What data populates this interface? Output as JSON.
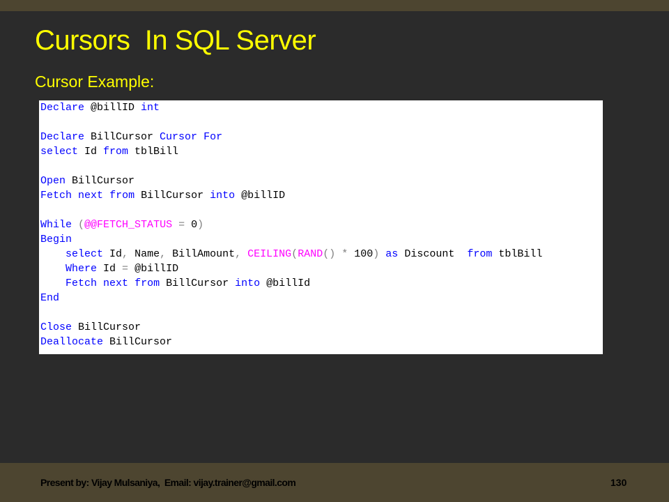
{
  "slide": {
    "title": "Cursors  In SQL Server",
    "subtitle": "Cursor Example:",
    "page_number": "130"
  },
  "footer": {
    "text": "Present by: Vijay Mulsaniya,  Email: vijay.trainer@gmail.com"
  },
  "colors": {
    "background": "#2b2b2b",
    "bar": "#4d4530",
    "title": "#ffff00",
    "keyword": "#0000ff",
    "function": "#ff00ff",
    "operator": "#808080",
    "text": "#000000"
  },
  "code": {
    "lines": [
      [
        {
          "t": "Declare",
          "c": "kw"
        },
        {
          "t": " @billID ",
          "c": "tx"
        },
        {
          "t": "int",
          "c": "kw"
        }
      ],
      [],
      [
        {
          "t": "Declare",
          "c": "kw"
        },
        {
          "t": " BillCursor ",
          "c": "tx"
        },
        {
          "t": "Cursor",
          "c": "kw"
        },
        {
          "t": " ",
          "c": "tx"
        },
        {
          "t": "For",
          "c": "kw"
        }
      ],
      [
        {
          "t": "select",
          "c": "kw"
        },
        {
          "t": " Id ",
          "c": "tx"
        },
        {
          "t": "from",
          "c": "kw"
        },
        {
          "t": " tblBill",
          "c": "tx"
        }
      ],
      [],
      [
        {
          "t": "Open",
          "c": "kw"
        },
        {
          "t": " BillCursor",
          "c": "tx"
        }
      ],
      [
        {
          "t": "Fetch",
          "c": "kw"
        },
        {
          "t": " ",
          "c": "tx"
        },
        {
          "t": "next",
          "c": "kw"
        },
        {
          "t": " ",
          "c": "tx"
        },
        {
          "t": "from",
          "c": "kw"
        },
        {
          "t": " BillCursor ",
          "c": "tx"
        },
        {
          "t": "into",
          "c": "kw"
        },
        {
          "t": " @billID",
          "c": "tx"
        }
      ],
      [],
      [
        {
          "t": "While",
          "c": "kw"
        },
        {
          "t": " ",
          "c": "tx"
        },
        {
          "t": "(",
          "c": "op"
        },
        {
          "t": "@@FETCH_STATUS",
          "c": "sv"
        },
        {
          "t": " = ",
          "c": "op"
        },
        {
          "t": "0",
          "c": "tx"
        },
        {
          "t": ")",
          "c": "op"
        }
      ],
      [
        {
          "t": "Begin",
          "c": "kw"
        }
      ],
      [
        {
          "t": "    ",
          "c": "tx"
        },
        {
          "t": "select",
          "c": "kw"
        },
        {
          "t": " Id",
          "c": "tx"
        },
        {
          "t": ",",
          "c": "op"
        },
        {
          "t": " Name",
          "c": "tx"
        },
        {
          "t": ",",
          "c": "op"
        },
        {
          "t": " BillAmount",
          "c": "tx"
        },
        {
          "t": ",",
          "c": "op"
        },
        {
          "t": " ",
          "c": "tx"
        },
        {
          "t": "CEILING",
          "c": "fn"
        },
        {
          "t": "(",
          "c": "op"
        },
        {
          "t": "RAND",
          "c": "fn"
        },
        {
          "t": "()",
          "c": "op"
        },
        {
          "t": " ",
          "c": "tx"
        },
        {
          "t": "*",
          "c": "op"
        },
        {
          "t": " 100",
          "c": "tx"
        },
        {
          "t": ")",
          "c": "op"
        },
        {
          "t": " ",
          "c": "tx"
        },
        {
          "t": "as",
          "c": "kw"
        },
        {
          "t": " Discount  ",
          "c": "tx"
        },
        {
          "t": "from",
          "c": "kw"
        },
        {
          "t": " tblBill",
          "c": "tx"
        }
      ],
      [
        {
          "t": "    ",
          "c": "tx"
        },
        {
          "t": "Where",
          "c": "kw"
        },
        {
          "t": " Id ",
          "c": "tx"
        },
        {
          "t": "=",
          "c": "op"
        },
        {
          "t": " @billID",
          "c": "tx"
        }
      ],
      [
        {
          "t": "    ",
          "c": "tx"
        },
        {
          "t": "Fetch",
          "c": "kw"
        },
        {
          "t": " ",
          "c": "tx"
        },
        {
          "t": "next",
          "c": "kw"
        },
        {
          "t": " ",
          "c": "tx"
        },
        {
          "t": "from",
          "c": "kw"
        },
        {
          "t": " BillCursor ",
          "c": "tx"
        },
        {
          "t": "into",
          "c": "kw"
        },
        {
          "t": " @billId",
          "c": "tx"
        }
      ],
      [
        {
          "t": "End",
          "c": "kw"
        }
      ],
      [],
      [
        {
          "t": "Close",
          "c": "kw"
        },
        {
          "t": " BillCursor",
          "c": "tx"
        }
      ],
      [
        {
          "t": "Deallocate",
          "c": "kw"
        },
        {
          "t": " BillCursor",
          "c": "tx"
        }
      ]
    ]
  }
}
